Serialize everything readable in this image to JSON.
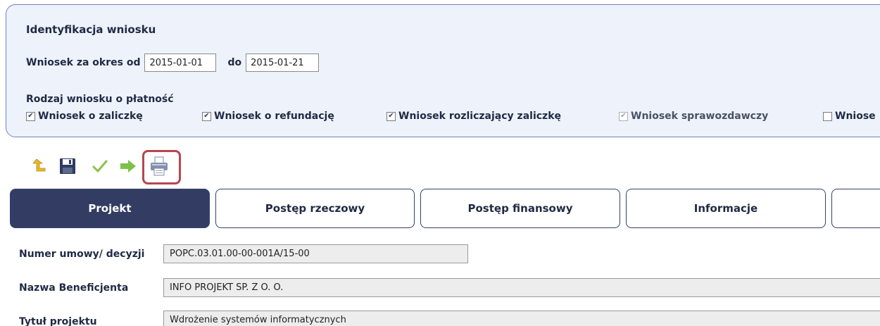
{
  "identification": {
    "title": "Identyfikacja wniosku",
    "period_label_from": "Wniosek za okres od",
    "date_from": "2015-01-01",
    "period_label_to": "do",
    "date_to": "2015-01-21",
    "kind_label": "Rodzaj wniosku o płatność",
    "kinds": [
      {
        "label": "Wniosek o zaliczkę",
        "checked": true
      },
      {
        "label": "Wniosek o refundację",
        "checked": true
      },
      {
        "label": "Wniosek rozliczający zaliczkę",
        "checked": true
      },
      {
        "label": "Wniosek sprawozdawczy",
        "checked": true,
        "disabled": true
      },
      {
        "label": "Wniose",
        "checked": false
      }
    ]
  },
  "toolbar": {
    "icons": [
      "undo-icon",
      "save-icon",
      "check-icon",
      "forward-arrow-icon",
      "print-icon"
    ],
    "colors": {
      "undo": "#e8b82a",
      "save": "#2e3b63",
      "check": "#8cc04b",
      "forward": "#7cc24a",
      "highlight": "#b5464f"
    }
  },
  "tabs": [
    {
      "label": "Projekt",
      "active": true
    },
    {
      "label": "Postęp rzeczowy",
      "active": false
    },
    {
      "label": "Postęp finansowy",
      "active": false
    },
    {
      "label": "Informacje",
      "active": false
    },
    {
      "label": "",
      "active": false
    }
  ],
  "fields": [
    {
      "label": "Numer umowy/ decyzji",
      "value": "POPC.03.01.00-00-001A/15-00"
    },
    {
      "label": "Nazwa Beneficjenta",
      "value": "INFO PROJEKT SP. Z O. O."
    },
    {
      "label": "Tytuł projektu",
      "value": "Wdrożenie systemów informatycznych"
    }
  ],
  "colors": {
    "accent": "#333d63",
    "panel_bg": "#eef2fa",
    "panel_border": "#6f86b8"
  }
}
